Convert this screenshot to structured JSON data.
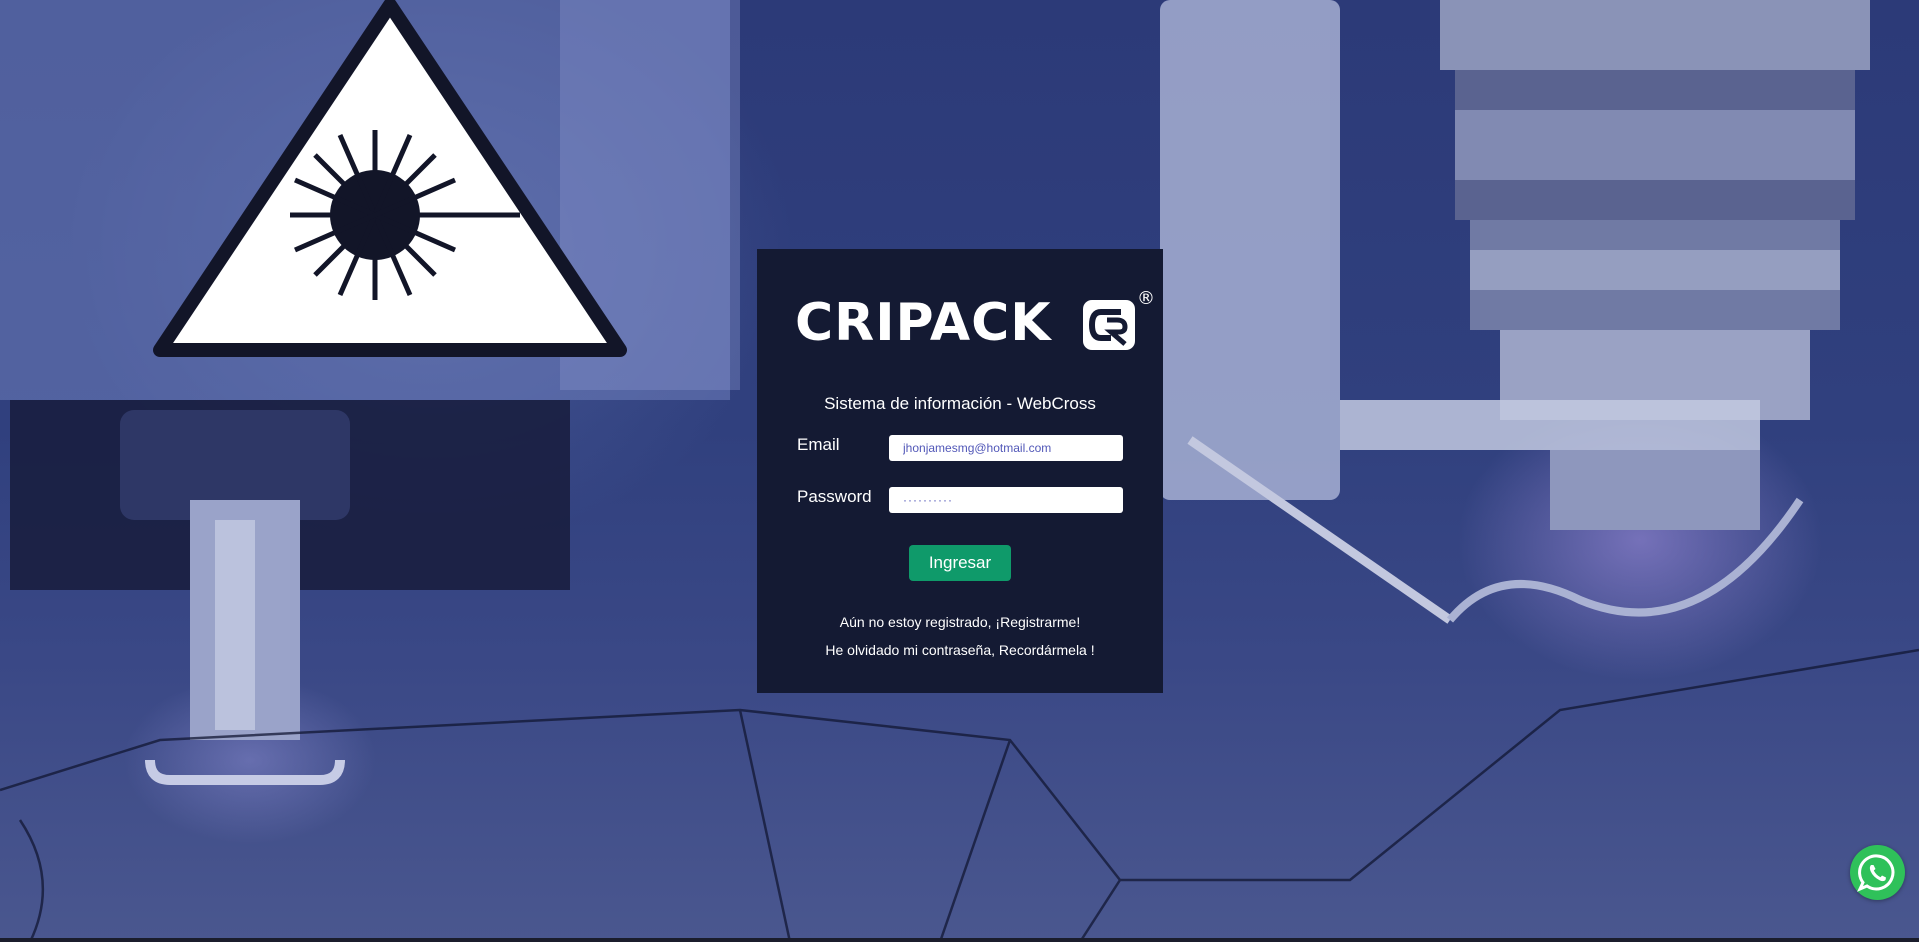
{
  "brand": {
    "logo_text": "CRIPACK",
    "registered_mark": "®"
  },
  "login": {
    "subtitle": "Sistema de información - WebCross",
    "email_label": "Email",
    "email_value": "jhonjamesmg@hotmail.com",
    "password_label": "Password",
    "password_value": "··········",
    "submit_label": "Ingresar",
    "register_text": "Aún no estoy registrado, ",
    "register_link": "¡Registrarme!",
    "forgot_text": "He olvidado mi contraseña, ",
    "forgot_link": "Recordármela !"
  },
  "colors": {
    "card_background": "#141a33",
    "submit_button": "#0f9a6a",
    "whatsapp": "#2fc15a"
  },
  "icons": {
    "whatsapp_button": "whatsapp-icon",
    "background": "laser-warning-icon"
  }
}
